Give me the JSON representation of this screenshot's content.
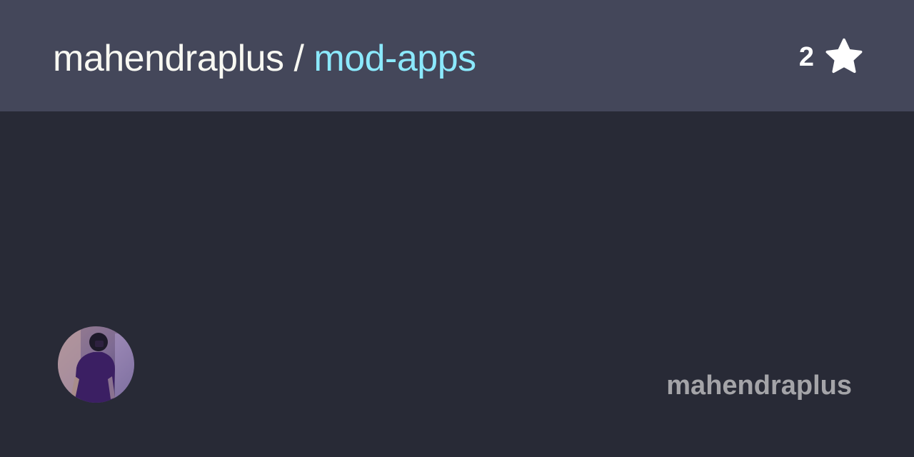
{
  "header": {
    "owner": "mahendraplus",
    "separator": " / ",
    "repo": "mod-apps",
    "star_count": "2",
    "star_icon": "star-icon"
  },
  "footer": {
    "owner_name": "mahendraplus",
    "avatar_icon": "avatar"
  },
  "colors": {
    "background": "#282a36",
    "header_background": "#44475a",
    "owner_text": "#f8f8f2",
    "repo_text": "#8be9fd",
    "footer_text": "#a4a4a8"
  }
}
